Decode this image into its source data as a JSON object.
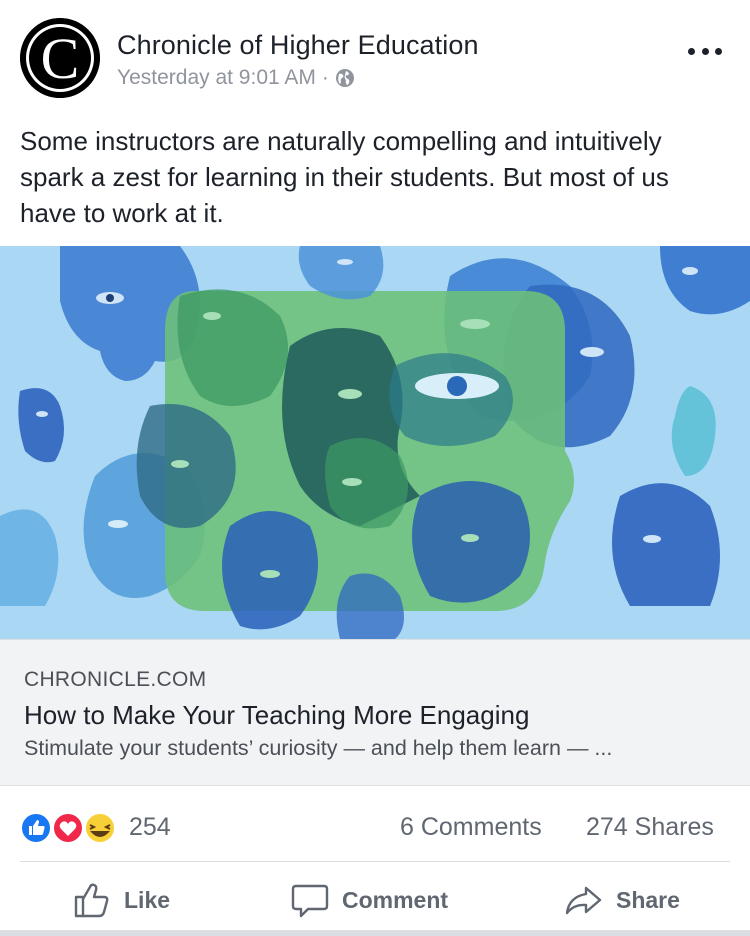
{
  "post": {
    "page_name": "Chronicle of Higher Education",
    "timestamp": "Yesterday at 9:01 AM",
    "separator": "·",
    "privacy_icon": "globe-icon",
    "more_icon": "more-options-icon",
    "text": "Some instructors are naturally compelling and intuitively spark a zest for learning in their students. But most of us have to work at it."
  },
  "link_preview": {
    "domain": "CHRONICLE.COM",
    "title": "How to Make Your Teaching More Engaging",
    "description": "Stimulate your students’ curiosity — and help them learn — ..."
  },
  "engagement": {
    "reactions": [
      "like-reaction-icon",
      "love-reaction-icon",
      "haha-reaction-icon"
    ],
    "reaction_count": "254",
    "comments": "6 Comments",
    "shares": "274 Shares"
  },
  "actions": {
    "like_label": "Like",
    "comment_label": "Comment",
    "share_label": "Share"
  },
  "colors": {
    "like_blue": "#1877f2",
    "love_red": "#f0284a",
    "haha_yellow": "#f7d038",
    "hero_bg": "#a9d7f4"
  }
}
